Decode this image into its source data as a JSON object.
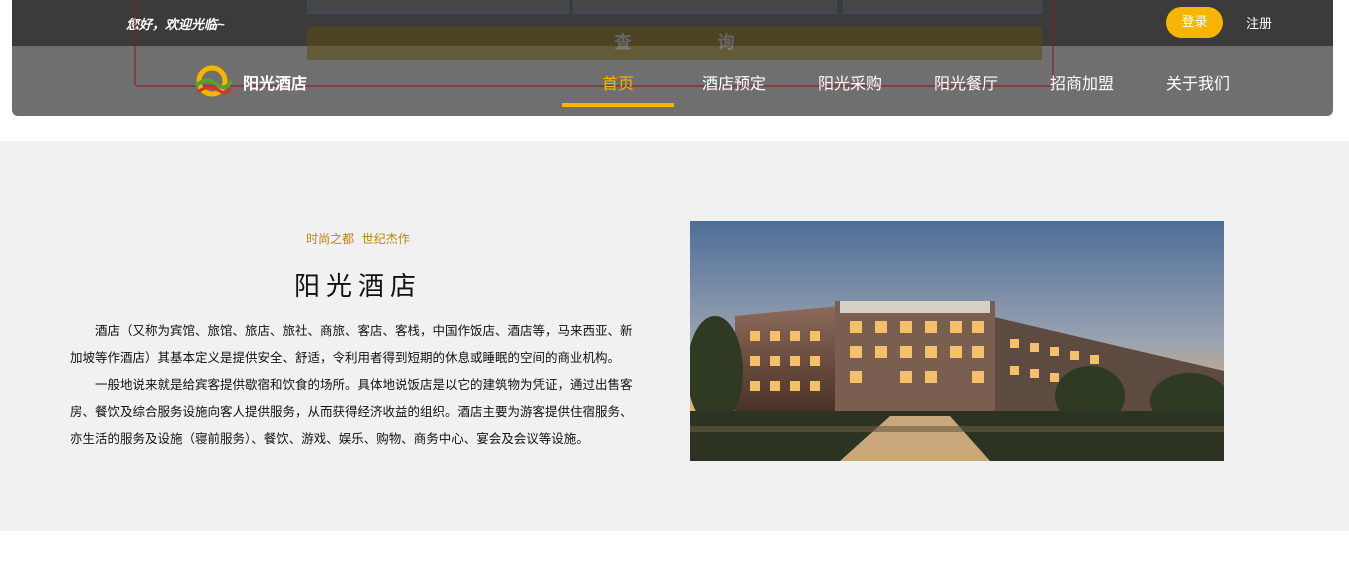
{
  "header": {
    "welcome": "您好，欢迎光临~",
    "login_label": "登录",
    "register_label": "注册",
    "brand": "阳光酒店",
    "search_button": "查 询",
    "nav": [
      {
        "label": "首页",
        "active": true
      },
      {
        "label": "酒店预定",
        "active": false
      },
      {
        "label": "阳光采购",
        "active": false
      },
      {
        "label": "阳光餐厅",
        "active": false
      },
      {
        "label": "招商加盟",
        "active": false
      },
      {
        "label": "关于我们",
        "active": false
      }
    ]
  },
  "intro": {
    "slogan": "时尚之都  世纪杰作",
    "title": "阳光酒店",
    "paragraphs": [
      "酒店（又称为宾馆、旅馆、旅店、旅社、商旅、客店、客栈，中国作饭店、酒店等，马来西亚、新加坡等作酒店）其基本定义是提供安全、舒适，令利用者得到短期的休息或睡眠的空间的商业机构。",
      "一般地说来就是给宾客提供歇宿和饮食的场所。具体地说饭店是以它的建筑物为凭证，通过出售客房、餐饮及综合服务设施向客人提供服务，从而获得经济收益的组织。酒店主要为游客提供住宿服务、亦生活的服务及设施（寝前服务）、餐饮、游戏、娱乐、购物、商务中心、宴会及会议等设施。"
    ],
    "photo": "hotel-building-photo"
  },
  "colors": {
    "accent": "#f7b500",
    "slogan": "#b8860b",
    "header_bg": "#6f6f6f",
    "topbar_bg": "#3b3b3b",
    "section_bg": "#f1f1f1"
  }
}
